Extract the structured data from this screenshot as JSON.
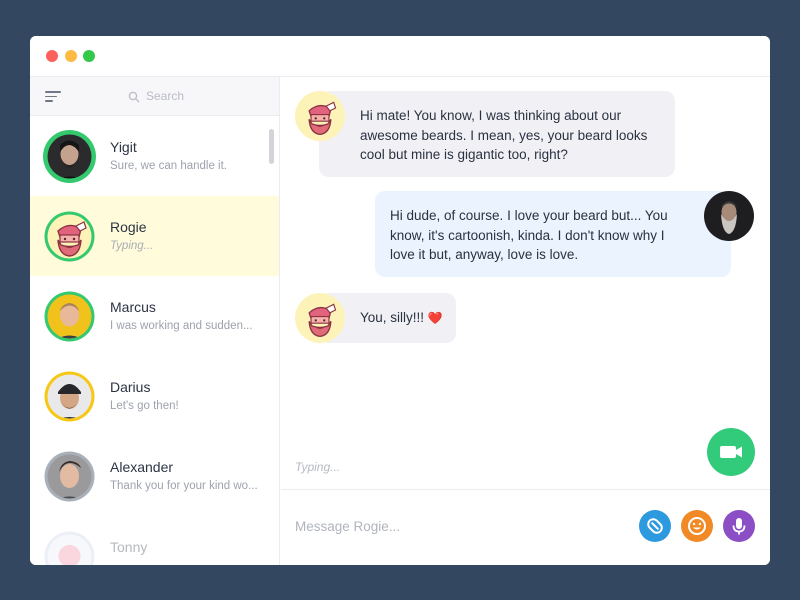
{
  "search": {
    "placeholder": "Search"
  },
  "contacts": [
    {
      "name": "Yigit",
      "preview": "Sure, we can handle it."
    },
    {
      "name": "Rogie",
      "preview": "Typing..."
    },
    {
      "name": "Marcus",
      "preview": "I was working and sudden..."
    },
    {
      "name": "Darius",
      "preview": "Let's go then!"
    },
    {
      "name": "Alexander",
      "preview": "Thank you for your kind wo..."
    },
    {
      "name": "Tonny",
      "preview": ""
    }
  ],
  "messages": [
    {
      "from": "Rogie",
      "lines": [
        "Hi mate! You know, I was thinking about our",
        "awesome beards. I mean, yes, your beard looks",
        "cool but mine is gigantic too, right?"
      ]
    },
    {
      "from": "me",
      "lines": [
        "Hi dude, of course. I love your beard but... You",
        "know, it's cartoonish, kinda. I don't know why I",
        "love it but, anyway, love is love."
      ]
    },
    {
      "from": "Rogie",
      "text": "You, silly!!!",
      "emoji": "❤️"
    }
  ],
  "chat": {
    "typing_indicator": "Typing...",
    "composer_placeholder": "Message Rogie..."
  },
  "colors": {
    "background": "#344760",
    "active_contact": "#fffbdb",
    "online_ring": "#35c96f",
    "away_ring": "#f6c716",
    "offline_ring": "#a9b0b9",
    "video_button": "#32cb7b",
    "attach_button": "#2d9ae0",
    "emoji_button": "#f18a26",
    "mic_button": "#8c4ec4"
  },
  "icons": {
    "menu": "menu-icon",
    "search": "search-icon",
    "video": "video-camera-icon",
    "attach": "paperclip-icon",
    "emoji": "smiley-icon",
    "mic": "microphone-icon"
  }
}
